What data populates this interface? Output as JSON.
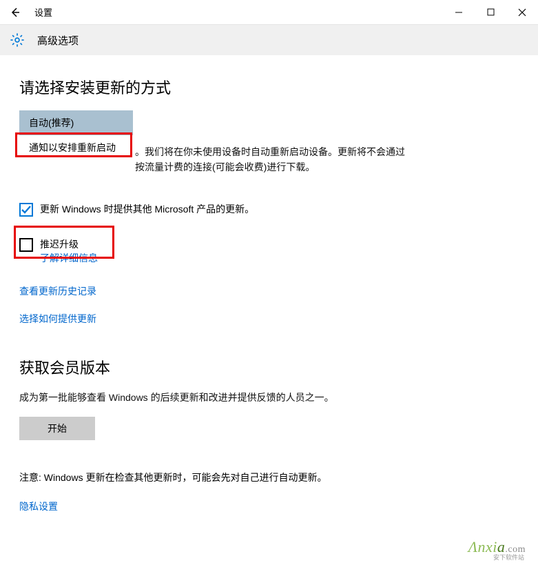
{
  "titlebar": {
    "title": "设置"
  },
  "subheader": {
    "title": "高级选项"
  },
  "section1": {
    "heading": "请选择安装更新的方式",
    "dropdown_selected": "自动(推荐)",
    "dropdown_option": "通知以安排重新启动",
    "desc_tail": "。我们将在你未使用设备时自动重新启动设备。更新将不会通过按流量计费的连接(可能会收费)进行下载。",
    "checkbox1_label": "更新 Windows 时提供其他 Microsoft 产品的更新。",
    "checkbox2_label": "推迟升级",
    "learn_more": "了解详细信息",
    "link_history": "查看更新历史记录",
    "link_delivery": "选择如何提供更新"
  },
  "section2": {
    "heading": "获取会员版本",
    "desc": "成为第一批能够查看 Windows 的后续更新和改进并提供反馈的人员之一。",
    "start_btn": "开始",
    "note": "注意: Windows 更新在检查其他更新时，可能会先对自己进行自动更新。",
    "privacy_link": "隐私设置"
  },
  "watermark": {
    "brand_pre": "Λnxi",
    "brand_post": "a",
    "domain": ".com",
    "sub": "安下软件站"
  }
}
